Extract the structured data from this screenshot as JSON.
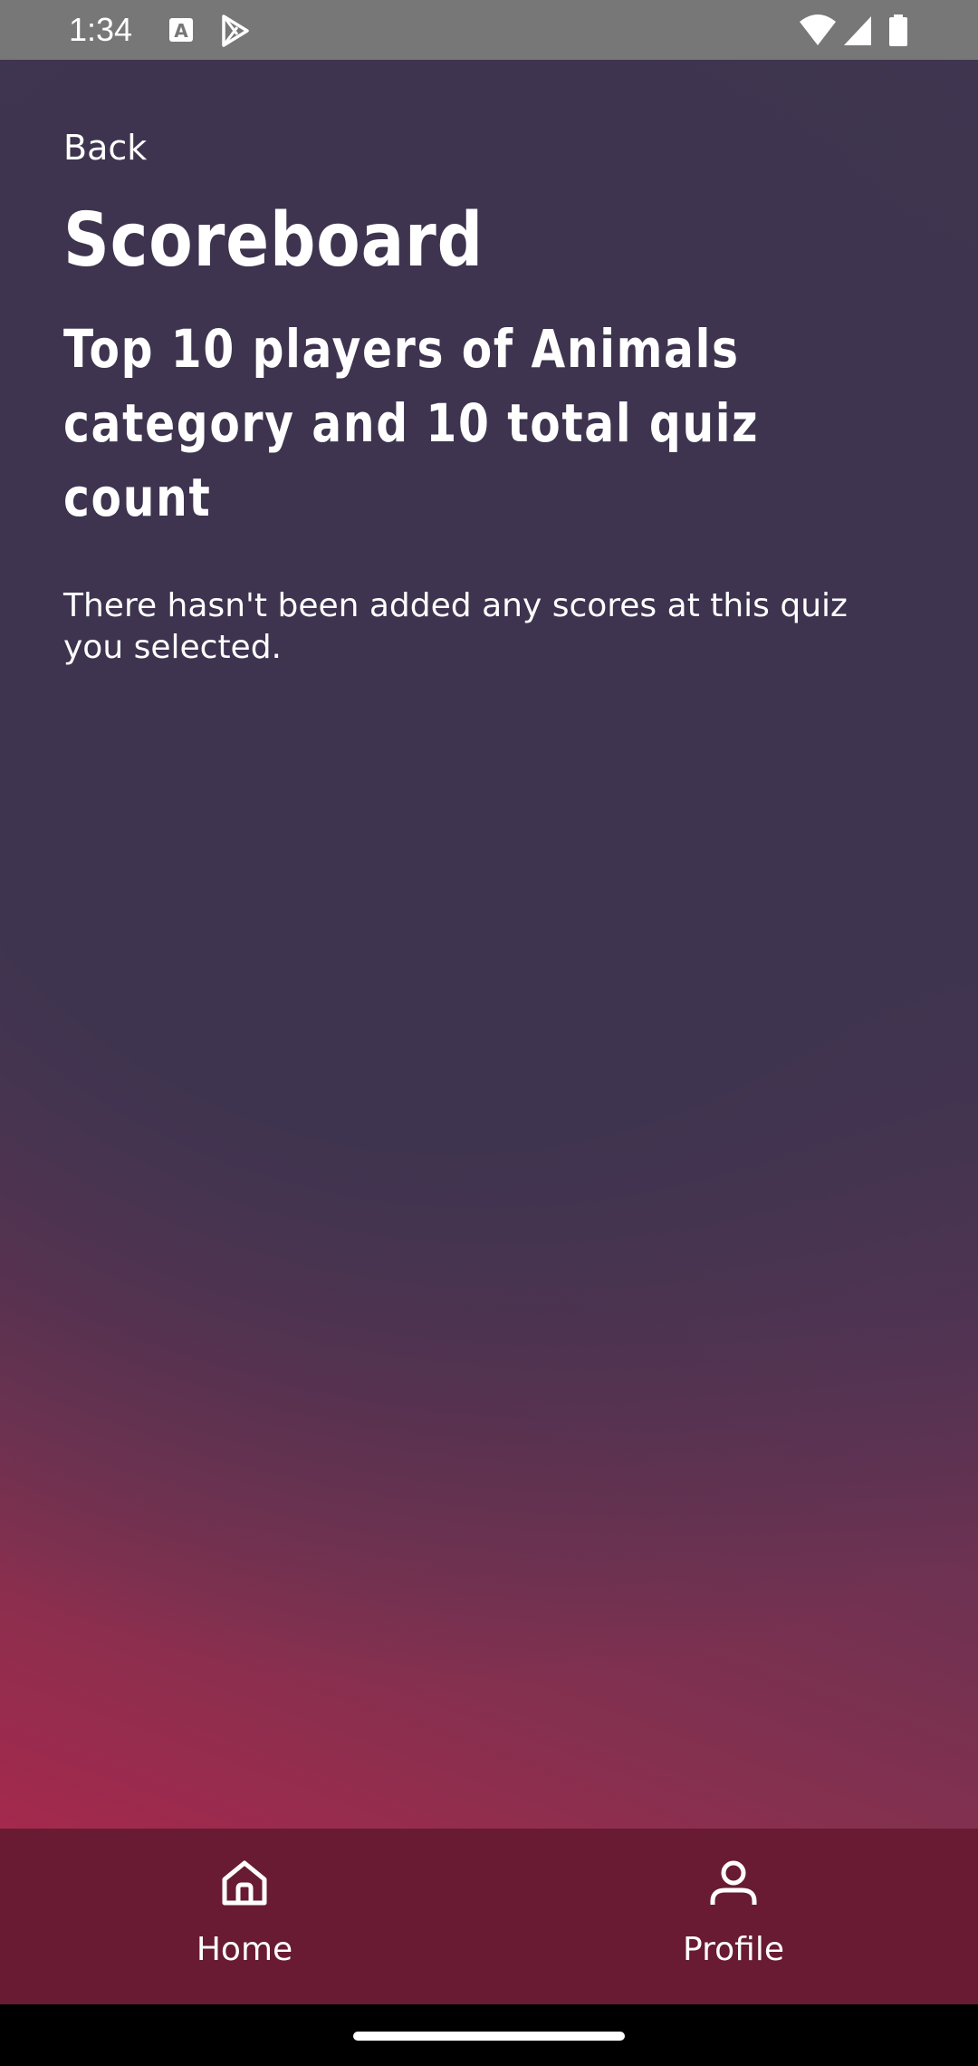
{
  "status_bar": {
    "time": "1:34",
    "left_icons": [
      "font-a-icon",
      "play-store-icon"
    ],
    "right_icons": [
      "wifi-icon",
      "cellular-signal-icon",
      "battery-icon"
    ]
  },
  "header": {
    "back_label": "Back",
    "title": "Scoreboard",
    "subtitle": "Top 10 players of Animals category and 10 total quiz count"
  },
  "content": {
    "empty_message": "There hasn't been added any scores at this quiz you selected."
  },
  "bottom_nav": {
    "items": [
      {
        "label": "Home",
        "icon": "home-icon"
      },
      {
        "label": "Profile",
        "icon": "person-icon"
      }
    ]
  },
  "colors": {
    "status_bar_bg": "#777777",
    "background_top": "#3e344f",
    "background_bottom": "#a4294d",
    "nav_bg": "#681b33",
    "text": "#ffffff"
  }
}
